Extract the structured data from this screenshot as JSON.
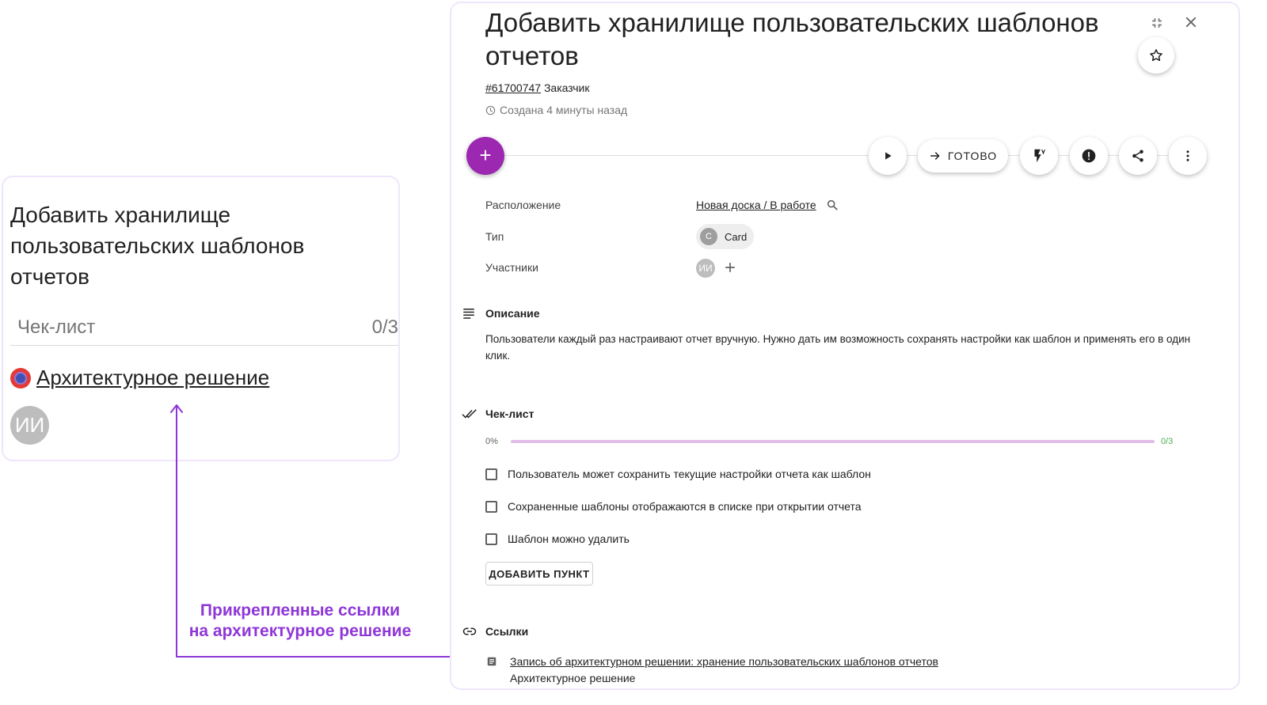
{
  "preview_card": {
    "title": "Добавить хранилище пользовательских шаблонов отчетов",
    "checklist_label": "Чек-лист",
    "checklist_count": "0/3",
    "link_text": "Архитектурное решение",
    "avatar_initials": "ИИ"
  },
  "annotation": {
    "line1": "Прикрепленные ссылки",
    "line2": "на архитектурное решение",
    "color": "#8e36d8"
  },
  "card": {
    "title": "Добавить хранилище пользовательских шаблонов отчетов",
    "id": "#61700747",
    "role": "Заказчик",
    "created": "Создана 4 минуты назад",
    "toolbar": {
      "add_icon": "+",
      "done_label": "ГОТОВО",
      "icons": [
        "play-icon",
        "arrow-right-icon",
        "flash-off-icon",
        "alert-icon",
        "share-icon",
        "more-vert-icon"
      ]
    },
    "properties": {
      "location_label": "Расположение",
      "location_value": "Новая доска / В работе",
      "type_label": "Тип",
      "type_avatar": "C",
      "type_value": "Card",
      "participants_label": "Участники",
      "participant_initials": "ИИ"
    },
    "description": {
      "title": "Описание",
      "text": "Пользователи каждый раз настраивают отчет вручную. Нужно дать им возможность сохранять настройки как шаблон и применять его в один клик."
    },
    "checklist": {
      "title": "Чек-лист",
      "progress_label": "0%",
      "progress": 0,
      "count": "0/3",
      "items": [
        {
          "text": "Пользователь может сохранить текущие настройки отчета как шаблон",
          "checked": false
        },
        {
          "text": "Сохраненные шаблоны отображаются в списке при открытии отчета",
          "checked": false
        },
        {
          "text": "Шаблон можно удалить",
          "checked": false
        }
      ],
      "add_button": "ДОБАВИТЬ ПУНКТ"
    },
    "links": {
      "title": "Ссылки",
      "item_title": "Запись об архитектурном решении: хранение пользовательских шаблонов отчетов",
      "item_subtitle": "Архитектурное решение"
    }
  },
  "colors": {
    "accent": "#9c27b0",
    "progress_track": "#e1bee7",
    "count_green": "#4caf50",
    "border": "#efe6fb"
  }
}
